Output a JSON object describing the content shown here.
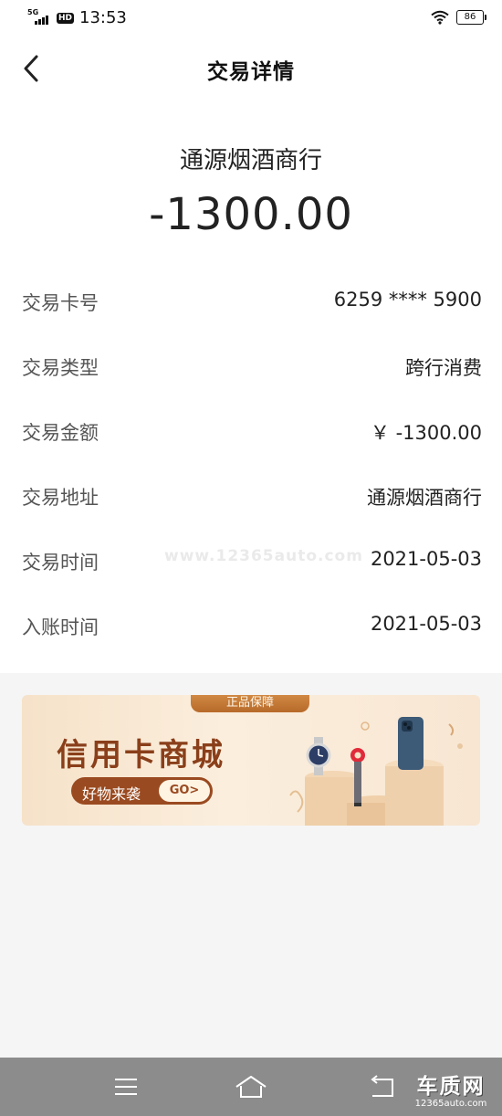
{
  "status_bar": {
    "network": "5G",
    "hd_badge": "HD",
    "time": "13:53",
    "battery": "86"
  },
  "header": {
    "title": "交易详情",
    "back_icon": "chevron-left-icon"
  },
  "summary": {
    "merchant": "通源烟酒商行",
    "amount": "-1300.00"
  },
  "details": [
    {
      "label": "交易卡号",
      "value": "6259 **** 5900"
    },
    {
      "label": "交易类型",
      "value": "跨行消费"
    },
    {
      "label": "交易金额",
      "value": "￥ -1300.00"
    },
    {
      "label": "交易地址",
      "value": "通源烟酒商行"
    },
    {
      "label": "交易时间",
      "value": "2021-05-03"
    },
    {
      "label": "入账时间",
      "value": "2021-05-03"
    }
  ],
  "watermark": "www.12365auto.com",
  "banner": {
    "tag": "正品保障",
    "title": "信用卡商城",
    "pill_label": "好物来袭",
    "go_label": "GO>"
  },
  "system_nav": {
    "menu_icon": "menu-icon",
    "home_icon": "home-icon",
    "back_icon": "back-icon"
  },
  "brand": {
    "name": "车质网",
    "url": "12365auto.com"
  },
  "colors": {
    "banner_brown": "#9a4a20",
    "banner_bg": "#f6e2c9",
    "nav_gray": "#8c8c8c",
    "page_gray": "#f5f5f5"
  }
}
